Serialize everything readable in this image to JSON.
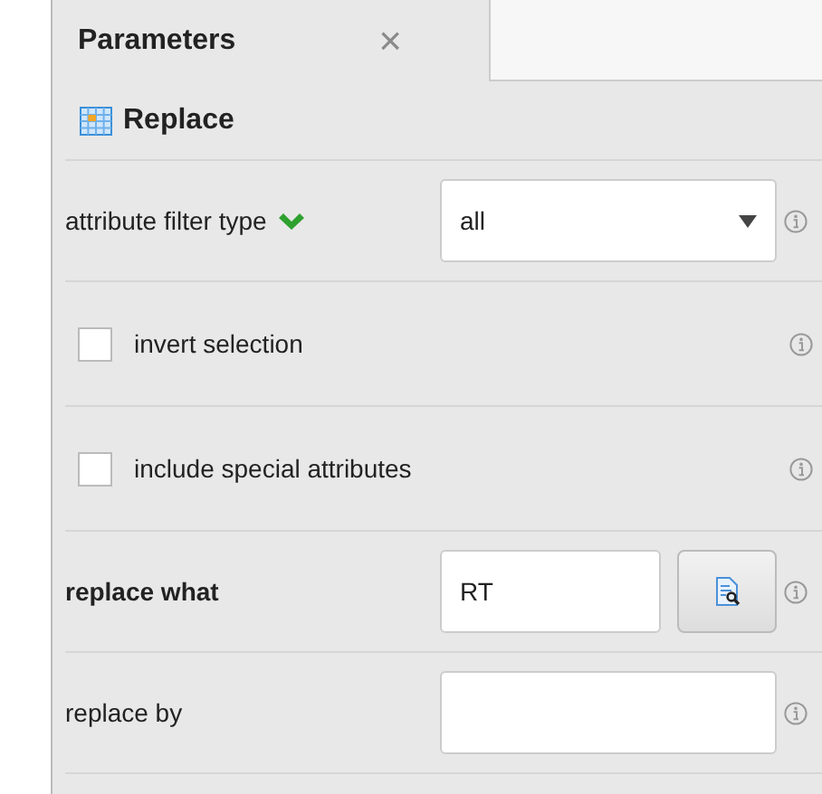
{
  "tab": {
    "label": "Parameters",
    "close": "×",
    "selected": true
  },
  "operator": {
    "title": "Replace"
  },
  "parameters": [
    {
      "kind": "select",
      "label": "attribute filter type",
      "required": false,
      "confirmed": true,
      "value": "all"
    },
    {
      "kind": "checkbox",
      "label": "invert selection",
      "required": false,
      "confirmed": false,
      "checked": false
    },
    {
      "kind": "checkbox",
      "label": "include special attributes",
      "required": false,
      "confirmed": false,
      "checked": false
    },
    {
      "kind": "text-button",
      "label": "replace what",
      "required": true,
      "confirmed": false,
      "value": "RT"
    },
    {
      "kind": "text",
      "label": "replace by",
      "required": false,
      "confirmed": false
    }
  ]
}
